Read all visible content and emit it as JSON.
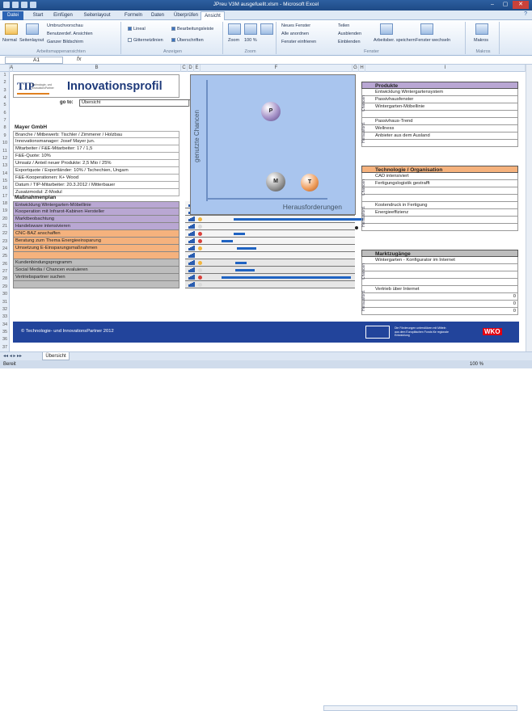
{
  "window": {
    "title": "JPreu V3M ausgefuellt.xlsm - Microsoft Excel"
  },
  "ribbon_tabs": [
    "Datei",
    "Start",
    "Einfügen",
    "Seitenlayout",
    "Formeln",
    "Daten",
    "Überprüfen",
    "Ansicht"
  ],
  "ribbon": {
    "views": {
      "normal": "Normal",
      "pagelayout": "Seitenlayout",
      "pagebreak": "Umbruchvorschau",
      "custom": "Benutzerdef. Ansichten",
      "fullscreen": "Ganzer Bildschirm",
      "label": "Arbeitsmappenansichten"
    },
    "show": {
      "lineal": "Lineal",
      "gridlines": "Gitternetzlinien",
      "formula": "Bearbeitungsleiste",
      "headings": "Überschriften",
      "label": "Anzeigen"
    },
    "zoom": {
      "zoom": "Zoom",
      "hundred": "100 %",
      "selection": "Fenster einfrieren",
      "label": "Zoom"
    },
    "window": {
      "new": "Neues Fenster",
      "arrange": "Alle anordnen",
      "freeze": "Fenster einfrieren",
      "split": "Teilen",
      "hide": "Ausblenden",
      "unhide": "Einblenden",
      "save": "Arbeitsber. speichern",
      "switch": "Fenster wechseln",
      "label": "Fenster"
    },
    "macros": {
      "macros": "Makros",
      "label": "Makros"
    }
  },
  "formula_bar": {
    "namebox": "A1",
    "fx": "fx",
    "content": ""
  },
  "columns": [
    "A",
    "B",
    "C",
    "D",
    "E",
    "F",
    "G",
    "H",
    "I"
  ],
  "rows": [
    "1",
    "2",
    "3",
    "4",
    "5",
    "6",
    "7",
    "8",
    "9",
    "10",
    "11",
    "12",
    "13",
    "14",
    "15",
    "16",
    "17",
    "18",
    "19",
    "20",
    "21",
    "22",
    "23",
    "24",
    "25",
    "26",
    "27",
    "28",
    "29",
    "30",
    "31",
    "32",
    "33",
    "34",
    "35",
    "36",
    "37"
  ],
  "brand": {
    "logo": "TIP",
    "logo_sub": "Technologie- und InnovationsPartner",
    "title": "Innovationsprofil"
  },
  "goto": {
    "label": "go to:",
    "value": "Übersicht"
  },
  "company": {
    "name": "Mayer GmbH",
    "rows": [
      "Branche / Mitbewerb: Tischler / Zimmerer / Holzbau",
      "Innovationsmanager: Josef Mayer jun.",
      "Mitarbeiter / F&E-Mitarbeiter: 17 / 1,5",
      "F&E-Quote: 10%",
      "Umsatz / Anteil neuer Produkte: 2,5 Mio / 25%",
      "Exportquote / Exportländer: 10% / Tschechien, Ungarn",
      "F&E-Kooperationen: K+ Wood",
      "Datum / TIP-Mitarbeiter: 20.3.2012 / Mitterbauer",
      "Zusatzmodul: Z-Modul"
    ]
  },
  "measures": {
    "title": "Maßnahmenplan",
    "col_a": "A",
    "col_p": "P",
    "items": [
      {
        "text": "Entwicklung Wintergarten-Möbellinie",
        "cat": "purple",
        "dot": "#d9403a"
      },
      {
        "text": "Kooperation mit Infrarot-Kabinen Hersteller",
        "cat": "purple",
        "dot": "#f2b53c"
      },
      {
        "text": "Marktbeobachtung",
        "cat": "purple",
        "dot": "#f2b53c"
      },
      {
        "text": "Handelsware intensivieren",
        "cat": "purple",
        "dot": "#d9d9d9"
      },
      {
        "text": "CNC-BAZ anschaffen",
        "cat": "orange",
        "dot": "#d9403a"
      },
      {
        "text": "Beratung zum Thema Energieeinsparung",
        "cat": "orange",
        "dot": "#d9403a"
      },
      {
        "text": "Umsetzung E-Einsparungsmaßnahmen",
        "cat": "orange",
        "dot": "#f2b53c"
      },
      {
        "text": "",
        "cat": "orange",
        "dot": ""
      },
      {
        "text": "Kundenbindungsprogramm",
        "cat": "grey",
        "dot": "#f2b53c"
      },
      {
        "text": "Social Media / Chancen evaluieren",
        "cat": "grey",
        "dot": "#d9d9d9"
      },
      {
        "text": "Vertriebspartner suchen",
        "cat": "grey",
        "dot": "#d9403a"
      },
      {
        "text": "",
        "cat": "grey",
        "dot": "#d9d9d9"
      }
    ]
  },
  "matrix": {
    "ylabel": "genutzte Chancen",
    "xlabel": "Herausforderungen",
    "balls": [
      {
        "label": "P"
      },
      {
        "label": "M"
      },
      {
        "label": "T"
      }
    ]
  },
  "products": {
    "title": "Produkte",
    "color": "#b9a7d3",
    "chancen_label": "Chancen",
    "heraus_label": "Herausford.",
    "chancen": [
      "Entwicklung Wintergartensystem",
      "Passivhausfenster",
      "Wintergarten-Möbellinie",
      ""
    ],
    "heraus": [
      "Passivhaus-Trend",
      "Wellness",
      "Anbieter aus dem Ausland",
      ""
    ]
  },
  "technology": {
    "title": "Technologie / Organisation",
    "color": "#f5b27d",
    "chancen_label": "Chancen",
    "heraus_label": "Herausford.",
    "chancen": [
      "CAD intensiviert",
      "Fertigungslogistik gestrafft",
      "",
      ""
    ],
    "heraus": [
      "Kostendruck in Fertigung",
      "Energieeffizienz",
      "",
      ""
    ]
  },
  "market": {
    "title": "Marktzugänge",
    "color": "#bdbdbd",
    "chancen_label": "Chancen",
    "heraus_label": "Herausford.",
    "chancen": [
      "Wintergarten - Konfigurator im Internet",
      "",
      "",
      ""
    ],
    "heraus": [
      "Vertrieb über Internet",
      "",
      "",
      ""
    ],
    "nums": [
      "0",
      "0",
      "0"
    ]
  },
  "footer": {
    "copyright": "© Technologie- und InnovationsPartner 2012",
    "eu_text": "Die Förderungen unterstützen mit Mitteln aus dem Europäischen Fonds für regionale Entwicklung",
    "wko": "WKO"
  },
  "sheet_tab": "Übersicht",
  "status": {
    "ready": "Bereit",
    "zoom": "100 %"
  }
}
